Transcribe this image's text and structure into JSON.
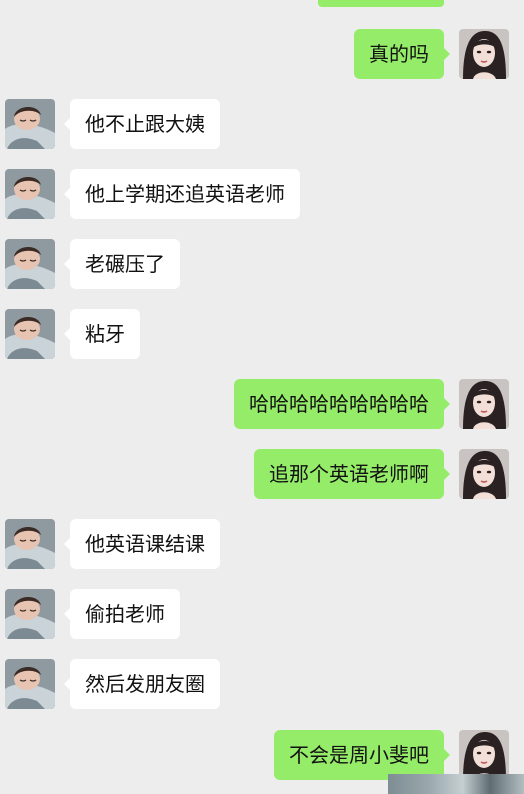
{
  "chat": {
    "messages": [
      {
        "side": "right",
        "text": "真的吗",
        "avatar": "girl-portrait-avatar"
      },
      {
        "side": "left",
        "text": "他不止跟大姨",
        "avatar": "sleeping-child-avatar"
      },
      {
        "side": "left",
        "text": "他上学期还追英语老师",
        "avatar": "sleeping-child-avatar"
      },
      {
        "side": "left",
        "text": "老碾压了",
        "avatar": "sleeping-child-avatar"
      },
      {
        "side": "left",
        "text": "粘牙",
        "avatar": "sleeping-child-avatar"
      },
      {
        "side": "right",
        "text": "哈哈哈哈哈哈哈哈哈",
        "avatar": "girl-portrait-avatar"
      },
      {
        "side": "right",
        "text": "追那个英语老师啊",
        "avatar": "girl-portrait-avatar"
      },
      {
        "side": "left",
        "text": "他英语课结课",
        "avatar": "sleeping-child-avatar"
      },
      {
        "side": "left",
        "text": "偷拍老师",
        "avatar": "sleeping-child-avatar"
      },
      {
        "side": "left",
        "text": "然后发朋友圈",
        "avatar": "sleeping-child-avatar"
      },
      {
        "side": "right",
        "text": "不会是周小斐吧",
        "avatar": "girl-portrait-avatar"
      }
    ]
  },
  "colors": {
    "background": "#ededed",
    "outgoing_bubble": "#95ec69",
    "incoming_bubble": "#ffffff",
    "text": "#111111"
  }
}
